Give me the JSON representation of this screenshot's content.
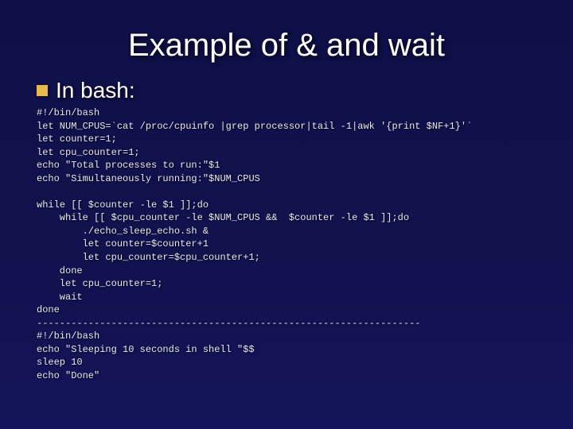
{
  "title": "Example of & and wait",
  "sub": "In bash:",
  "code": "#!/bin/bash\nlet NUM_CPUS=`cat /proc/cpuinfo |grep processor|tail -1|awk '{print $NF+1}'`\nlet counter=1;\nlet cpu_counter=1;\necho \"Total processes to run:\"$1\necho \"Simultaneously running:\"$NUM_CPUS\n\nwhile [[ $counter -le $1 ]];do\n    while [[ $cpu_counter -le $NUM_CPUS &&  $counter -le $1 ]];do\n        ./echo_sleep_echo.sh &\n        let counter=$counter+1\n        let cpu_counter=$cpu_counter+1;\n    done\n    let cpu_counter=1;\n    wait\ndone\n-------------------------------------------------------------------\n#!/bin/bash\necho \"Sleeping 10 seconds in shell \"$$\nsleep 10\necho \"Done\""
}
